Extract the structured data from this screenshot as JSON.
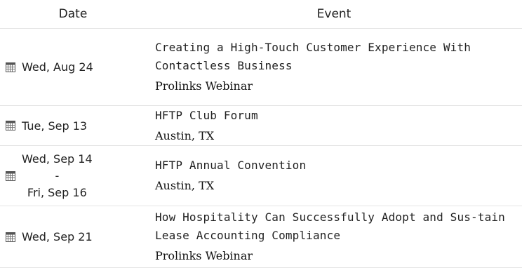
{
  "table": {
    "headers": {
      "date": "Date",
      "event": "Event"
    },
    "rows": [
      {
        "date": "Wed, Aug 24",
        "title": "Creating a High-Touch Customer Experience With Contactless Business",
        "location": "Prolinks Webinar"
      },
      {
        "date": "Tue, Sep 13",
        "title": "HFTP Club Forum",
        "location": "Austin, TX"
      },
      {
        "date_start": "Wed, Sep 14",
        "date_sep": "-",
        "date_end": "Fri, Sep 16",
        "title": "HFTP Annual Convention",
        "location": "Austin, TX"
      },
      {
        "date": "Wed, Sep 21",
        "title": "How Hospitality Can Successfully Adopt and Sustain Lease Accounting Compliance",
        "title_display": "How Hospitality Can Successfully Adopt and Sus-tain Lease Accounting Compliance",
        "location": "Prolinks Webinar"
      }
    ]
  },
  "icons": {
    "date_icon": "calendar-icon"
  }
}
